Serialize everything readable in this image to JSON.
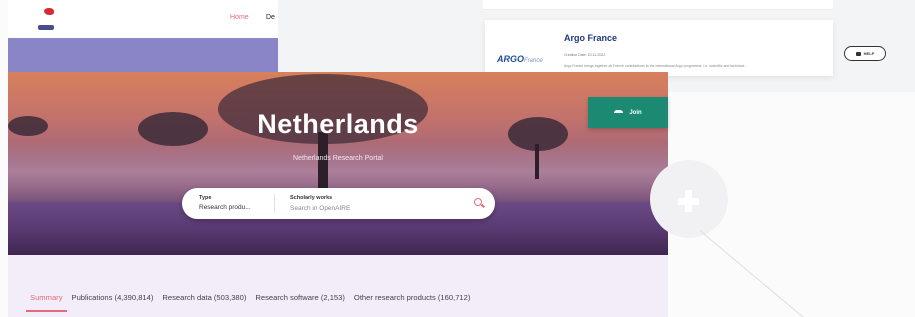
{
  "header": {
    "nav": {
      "home": "Home",
      "next": "De"
    }
  },
  "argo": {
    "title": "Argo France",
    "creation_date": "Creation Date: 10-11-2022",
    "description": "Argo France brings together all French contributions to the international Argo programme, i.e. scientific and technical...",
    "logo_main": "ARGO",
    "logo_sub": "France"
  },
  "help": {
    "label": "HELP"
  },
  "hero": {
    "title": "Netherlands",
    "subtitle": "Netherlands Research Portal",
    "join_label": "Join"
  },
  "search": {
    "type_label": "Type",
    "type_value": "Research produ...",
    "scope_label": "Scholarly works",
    "placeholder": "Search in OpenAIRE"
  },
  "tabs": [
    {
      "label": "Summary",
      "active": true
    },
    {
      "label": "Publications (4,390,814)"
    },
    {
      "label": "Research data (503,380)"
    },
    {
      "label": "Research software (2,153)"
    },
    {
      "label": "Other research products (160,712)"
    }
  ],
  "colors": {
    "accent": "#e46b7a",
    "join": "#1c8a72",
    "purple_band": "#8a85c7",
    "argo_title": "#1e3a82"
  }
}
